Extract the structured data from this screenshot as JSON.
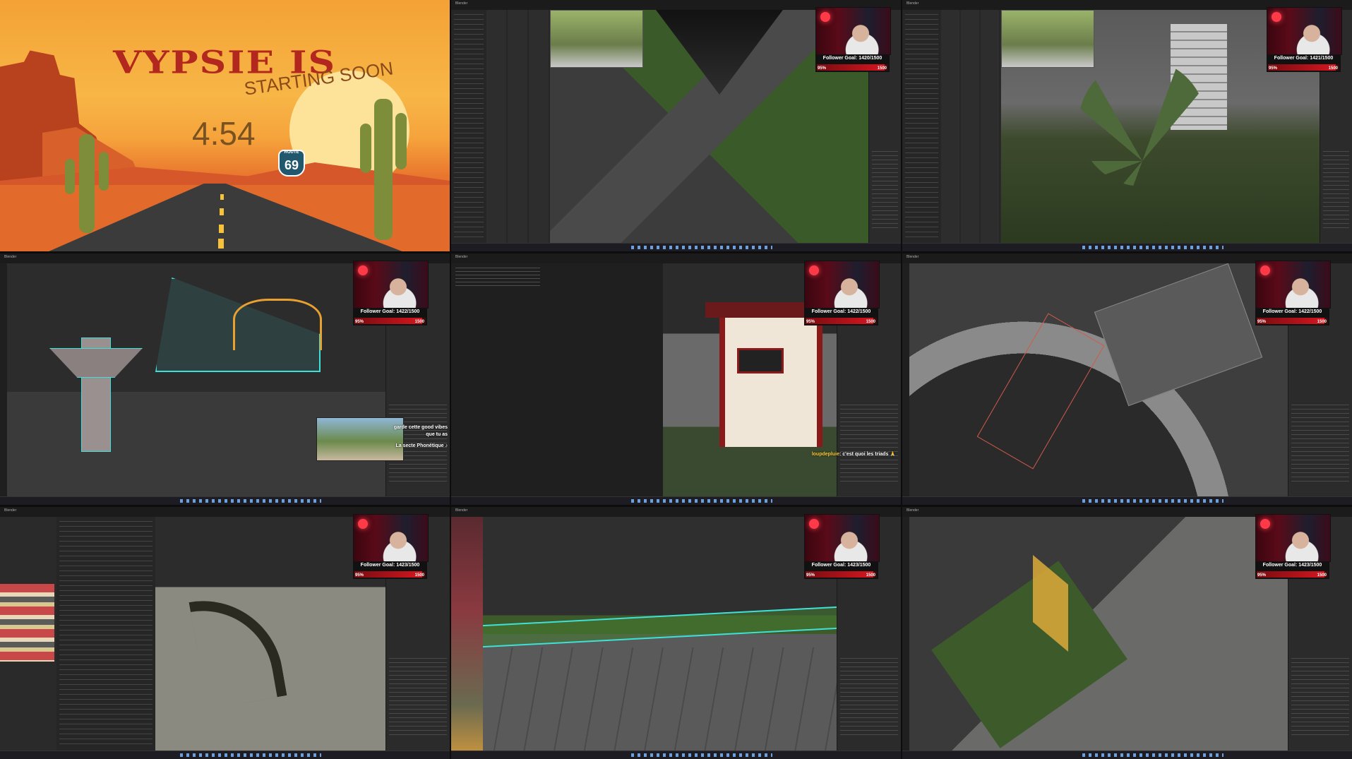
{
  "title_card": {
    "headline": "VYPSIE IS",
    "subline": "STARTING SOON",
    "timer": "4:54",
    "route_label": "ROUTE",
    "route_number": "69"
  },
  "window_title": "Blender",
  "goal_max_label": "1500",
  "goal_pct_label": "95%",
  "goal_fill_fraction": 0.95,
  "goal_label_prefix": "Follower Goal: ",
  "tiles": [
    {
      "goal_text": "Follower Goal: 1420/1500"
    },
    {
      "goal_text": "Follower Goal: 1421/1500"
    },
    {
      "goal_text": "Follower Goal: 1422/1500"
    },
    {
      "goal_text": "Follower Goal: 1422/1500"
    },
    {
      "goal_text": "Follower Goal: 1422/1500"
    },
    {
      "goal_text": "Follower Goal: 1423/1500"
    },
    {
      "goal_text": "Follower Goal: 1423/1500"
    },
    {
      "goal_text": "Follower Goal: 1423/1500"
    }
  ],
  "chat_messages": [
    {
      "text": "garde cette good vibes que tu as"
    },
    {
      "text": "La secte Phonétique ♪"
    },
    {
      "user": "loupdepluie",
      "text": ": c'est quoi les triads 🙏"
    }
  ],
  "colors": {
    "accent_red": "#d41620",
    "wireframe_cyan": "#3fe0d8",
    "selection_orange": "#e8a030",
    "blender_bg": "#2b2b2b"
  },
  "icons": [
    "record-icon",
    "route-shield-icon"
  ]
}
